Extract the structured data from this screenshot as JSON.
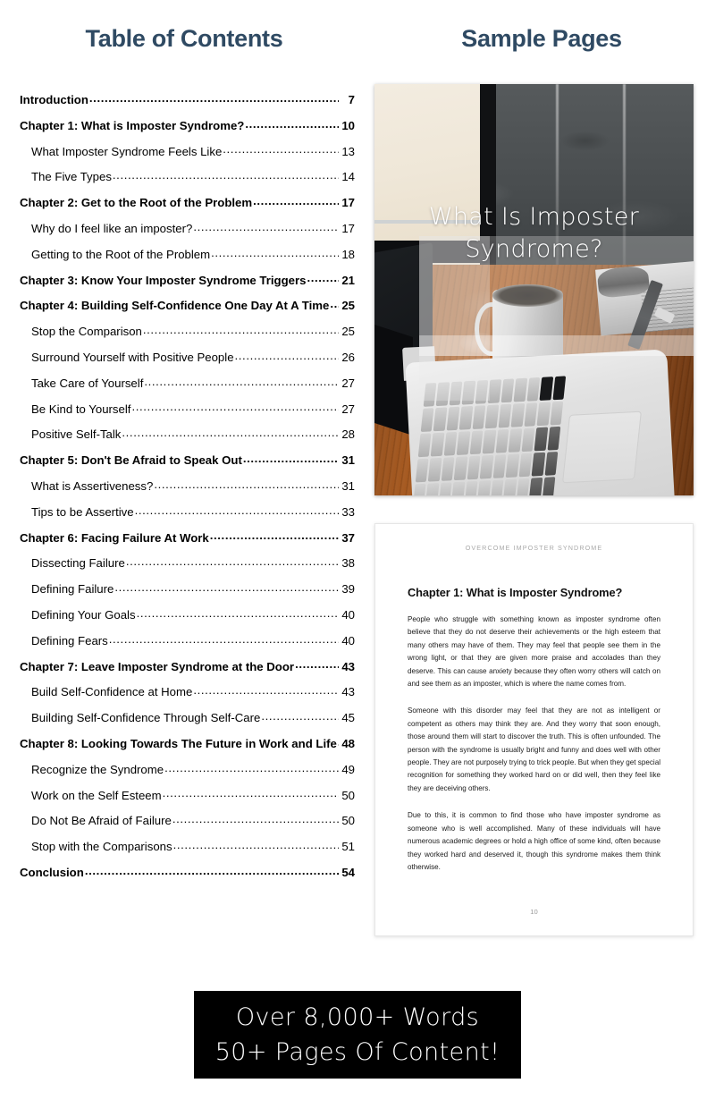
{
  "headings": {
    "toc": "Table of Contents",
    "sample": "Sample Pages"
  },
  "colors": {
    "heading": "#2f4a63",
    "banner_bg": "#000000",
    "banner_text": "#ffffff",
    "body_text": "#1a1a1a"
  },
  "toc": {
    "entries": [
      {
        "level": 1,
        "title": "Introduction",
        "page": "7"
      },
      {
        "level": 1,
        "title": "Chapter 1: What is Imposter Syndrome?",
        "page": "10"
      },
      {
        "level": 2,
        "title": "What Imposter Syndrome Feels Like",
        "page": "13"
      },
      {
        "level": 2,
        "title": "The Five Types",
        "page": "14"
      },
      {
        "level": 1,
        "title": "Chapter 2: Get to the Root of the Problem",
        "page": "17"
      },
      {
        "level": 2,
        "title": "Why do I feel like an imposter?",
        "page": "17"
      },
      {
        "level": 2,
        "title": "Getting to the Root of the Problem",
        "page": "18"
      },
      {
        "level": 1,
        "title": "Chapter 3: Know Your Imposter Syndrome Triggers",
        "page": "21"
      },
      {
        "level": 1,
        "title": "Chapter 4: Building Self-Confidence One Day At A Time",
        "page": "25"
      },
      {
        "level": 2,
        "title": "Stop the Comparison",
        "page": "25"
      },
      {
        "level": 2,
        "title": "Surround Yourself with Positive People",
        "page": "26"
      },
      {
        "level": 2,
        "title": "Take Care of Yourself",
        "page": "27"
      },
      {
        "level": 2,
        "title": "Be Kind to Yourself",
        "page": "27"
      },
      {
        "level": 2,
        "title": "Positive Self-Talk",
        "page": "28"
      },
      {
        "level": 1,
        "title": "Chapter 5: Don't Be Afraid to Speak Out",
        "page": "31"
      },
      {
        "level": 2,
        "title": "What is Assertiveness?",
        "page": "31"
      },
      {
        "level": 2,
        "title": "Tips to be Assertive",
        "page": "33"
      },
      {
        "level": 1,
        "title": "Chapter 6: Facing Failure At Work",
        "page": "37"
      },
      {
        "level": 2,
        "title": "Dissecting Failure",
        "page": "38"
      },
      {
        "level": 2,
        "title": "Defining Failure",
        "page": "39"
      },
      {
        "level": 2,
        "title": "Defining Your Goals",
        "page": "40"
      },
      {
        "level": 2,
        "title": "Defining Fears",
        "page": "40"
      },
      {
        "level": 1,
        "title": "Chapter 7: Leave Imposter Syndrome at the Door",
        "page": "43"
      },
      {
        "level": 2,
        "title": "Build Self-Confidence at Home",
        "page": "43"
      },
      {
        "level": 2,
        "title": "Building Self-Confidence Through Self-Care",
        "page": "45"
      },
      {
        "level": 1,
        "title": "Chapter 8: Looking Towards The Future in Work and Life",
        "page": "48"
      },
      {
        "level": 2,
        "title": "Recognize the Syndrome",
        "page": "49"
      },
      {
        "level": 2,
        "title": "Work on the Self Esteem",
        "page": "50"
      },
      {
        "level": 2,
        "title": "Do Not Be Afraid of Failure",
        "page": "50"
      },
      {
        "level": 2,
        "title": "Stop with the Comparisons",
        "page": "51"
      },
      {
        "level": 1,
        "title": "Conclusion",
        "page": "54"
      }
    ]
  },
  "cover": {
    "title_line1": "What Is Imposter",
    "title_line2": "Syndrome?",
    "scene": "desk-with-laptop-coffee-mug-notebook-pen-by-window"
  },
  "sample_page": {
    "running_head": "OVERCOME IMPOSTER SYNDROME",
    "chapter_title": "Chapter 1: What is Imposter Syndrome?",
    "paragraphs": [
      "People who struggle with something known as imposter syndrome often believe that they do not deserve their achievements or the high esteem that many others may have of them. They may feel that people see them in the wrong light, or that they are given more praise and accolades than they deserve. This can cause anxiety because they often worry others will catch on and see them as an imposter, which is where the name comes from.",
      "Someone with this disorder may feel that they are not as intelligent or competent as others may think they are. And they worry that soon enough, those around them will start to discover the truth. This is often unfounded. The person with the syndrome is usually bright and funny and does well with other people. They are not purposely trying to trick people. But when they get special recognition for something they worked hard on or did well, then they feel like they are deceiving others.",
      "Due to this, it is common to find those who have imposter syndrome as someone who is well accomplished. Many of these individuals will have numerous academic degrees or hold a high office of some kind, often because they worked hard and deserved it, though this syndrome makes them think otherwise."
    ],
    "page_number": "10"
  },
  "banner": {
    "line1": "Over 8,000+ Words",
    "line2": "50+ Pages Of Content!"
  }
}
